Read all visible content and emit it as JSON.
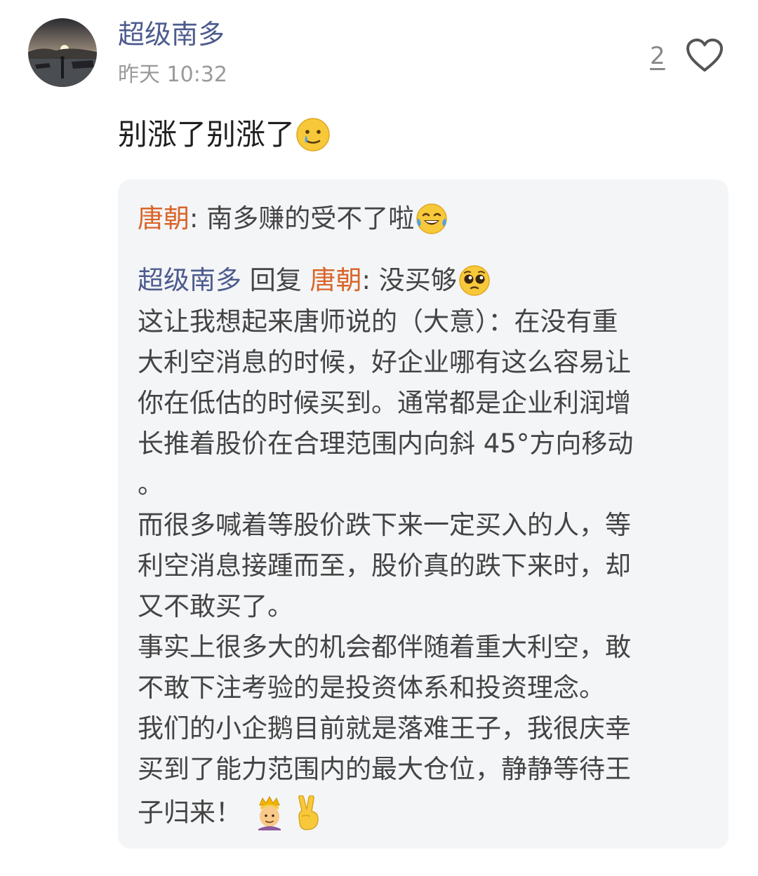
{
  "comment": {
    "username": "超级南多",
    "timestamp": "昨天 10:32",
    "like_count": "2",
    "text": "别涨了别涨了",
    "text_emoji": "sad-tear-smile-emoji"
  },
  "reply_box": {
    "first_reply": {
      "author": "唐朝",
      "separator": ": ",
      "text": "南多赚的受不了啦",
      "emoji": "tears-of-joy-emoji"
    },
    "second_reply": {
      "author": "超级南多",
      "reply_word": " 回复 ",
      "target": "唐朝",
      "separator": ": ",
      "text": "没买够",
      "emoji": "pleading-face-emoji"
    },
    "body_lines": [
      "这让我想起来唐师说的（大意）：在没有重",
      "大利空消息的时候，好企业哪有这么容易让",
      "你在低估的时候买到。通常都是企业利润增",
      "长推着股价在合理范围内向斜 45°方向移动",
      "。",
      "而很多喊着等股价跌下来一定买入的人，等",
      "利空消息接踵而至，股价真的跌下来时，却",
      "又不敢买了。",
      "事实上很多大的机会都伴随着重大利空，敢",
      "不敢下注考验的是投资体系和投资理念。",
      "我们的小企鹅目前就是落难王子，我很庆幸",
      "买到了能力范围内的最大仓位，静静等待王"
    ],
    "last_line": "子归来！",
    "last_line_emojis": [
      "prince-emoji",
      "victory-hand-emoji"
    ]
  },
  "colors": {
    "username": "#4d5b8e",
    "reply_author": "#d9652a",
    "timestamp": "#9a9a9a",
    "reply_bg": "#f4f5f7"
  }
}
